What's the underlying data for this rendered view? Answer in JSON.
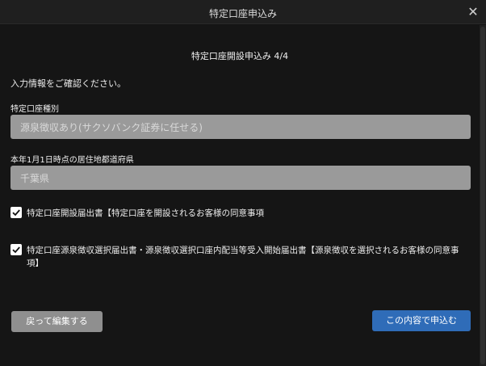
{
  "window": {
    "title": "特定口座申込み",
    "close_glyph": "✕"
  },
  "form": {
    "step_title": "特定口座開設申込み 4/4",
    "intro": "入力情報をご確認ください。",
    "account_type": {
      "label": "特定口座種別",
      "value": "源泉徴収あり(サクソバンク証券に任せる)"
    },
    "prefecture": {
      "label": "本年1月1日時点の居住地都道府県",
      "value": "千葉県"
    },
    "checkboxes": [
      {
        "label": "特定口座開設届出書【特定口座を開設されるお客様の同意事項",
        "checked": true
      },
      {
        "label": "特定口座源泉徴収選択届出書・源泉徴収選択口座内配当等受入開始届出書【源泉徴収を選択されるお客様の同意事項】",
        "checked": true
      }
    ]
  },
  "buttons": {
    "back": "戻って編集する",
    "submit": "この内容で申込む"
  },
  "colors": {
    "background": "#151515",
    "field_bg": "#9a9a9a",
    "secondary_button": "#8f8f8f",
    "primary_button": "#2f6cb8"
  }
}
